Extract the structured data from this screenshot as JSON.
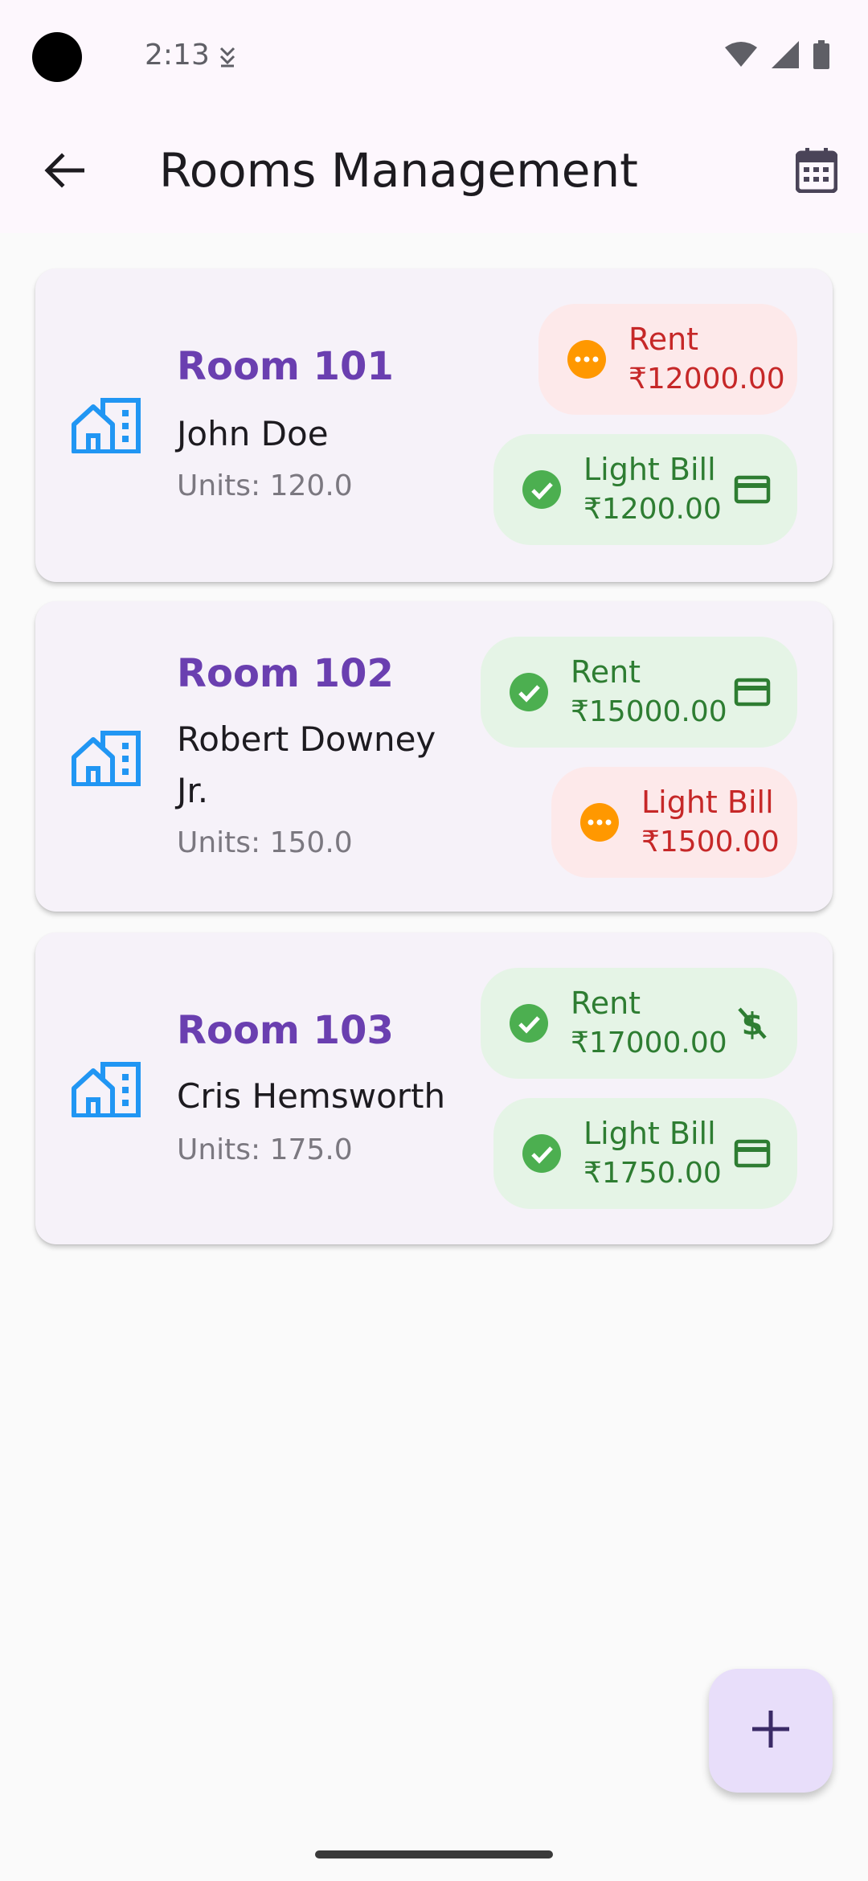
{
  "status_bar": {
    "time": "2:13"
  },
  "header": {
    "title": "Rooms Management"
  },
  "rooms": [
    {
      "name": "Room 101",
      "tenant": "John Doe",
      "units": "Units: 120.0",
      "bills": [
        {
          "label": "Rent",
          "amount": "₹12000.00",
          "status": "pending"
        },
        {
          "label": "Light Bill",
          "amount": "₹1200.00",
          "status": "paid",
          "action_icon": "credit-card-icon"
        }
      ]
    },
    {
      "name": "Room 102",
      "tenant": "Robert Downey Jr.",
      "units": "Units: 150.0",
      "bills": [
        {
          "label": "Rent",
          "amount": "₹15000.00",
          "status": "paid",
          "action_icon": "credit-card-icon"
        },
        {
          "label": "Light Bill",
          "amount": "₹1500.00",
          "status": "pending"
        }
      ]
    },
    {
      "name": "Room 103",
      "tenant": "Cris Hemsworth",
      "units": "Units: 175.0",
      "bills": [
        {
          "label": "Rent",
          "amount": "₹17000.00",
          "status": "paid",
          "action_icon": "money-off-icon"
        },
        {
          "label": "Light Bill",
          "amount": "₹1750.00",
          "status": "paid",
          "action_icon": "credit-card-icon"
        }
      ]
    }
  ],
  "colors": {
    "paid_bg": "#e5f4e6",
    "paid_text": "#2e7d32",
    "paid_icon": "#4caf50",
    "pending_bg": "#fde9ea",
    "pending_text": "#c62828",
    "pending_icon": "#ff9800",
    "room_name": "#6a3fb0",
    "building_icon": "#2196f3",
    "fab_bg": "#e8defa"
  },
  "fab": {
    "icon": "plus-icon"
  }
}
